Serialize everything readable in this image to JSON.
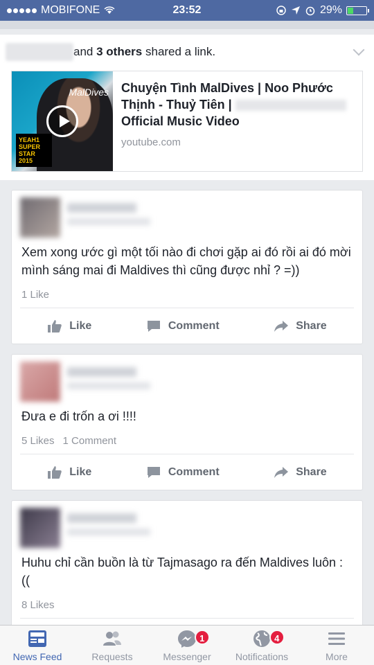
{
  "status_bar": {
    "carrier": "MOBIFONE",
    "time": "23:52",
    "battery_percent": "29%",
    "battery_level": 0.29,
    "signal_dots_filled": 5
  },
  "shared_story": {
    "others": "3 others",
    "text_prefix": "and",
    "text_suffix": "shared a link.",
    "link": {
      "title_line1": "Chuyện Tình MalDives | Noo Phước",
      "title_line2": "Thịnh - Thuỷ Tiên |",
      "title_line3": "Official Music Video",
      "domain": "youtube.com",
      "thumb_text": "MalDives",
      "thumb_badge": "YEAH1 SUPER STAR 2015"
    }
  },
  "comments": [
    {
      "text": "Xem xong ước gì một tối nào đi chơi gặp ai đó rồi ai đó mời mình sáng mai đi Maldives thì cũng được nhỉ ? =))",
      "likes": "1 Like",
      "comments": ""
    },
    {
      "text": "Đưa e đi trốn a ơi !!!!",
      "likes": "5 Likes",
      "comments": "1 Comment"
    },
    {
      "text": "Huhu chỉ cần buồn là từ Tajmasago ra đến Maldives luôn : ((",
      "likes": "8 Likes",
      "comments": ""
    }
  ],
  "actions": {
    "like": "Like",
    "comment": "Comment",
    "share": "Share"
  },
  "tab_bar": {
    "news_feed": "News Feed",
    "requests": "Requests",
    "messenger": "Messenger",
    "messenger_badge": "1",
    "notifications": "Notifications",
    "notifications_badge": "4",
    "more": "More"
  },
  "colors": {
    "status_bar": "#4e69a2",
    "active_tab": "#4267b2",
    "badge": "#e41e3f"
  }
}
